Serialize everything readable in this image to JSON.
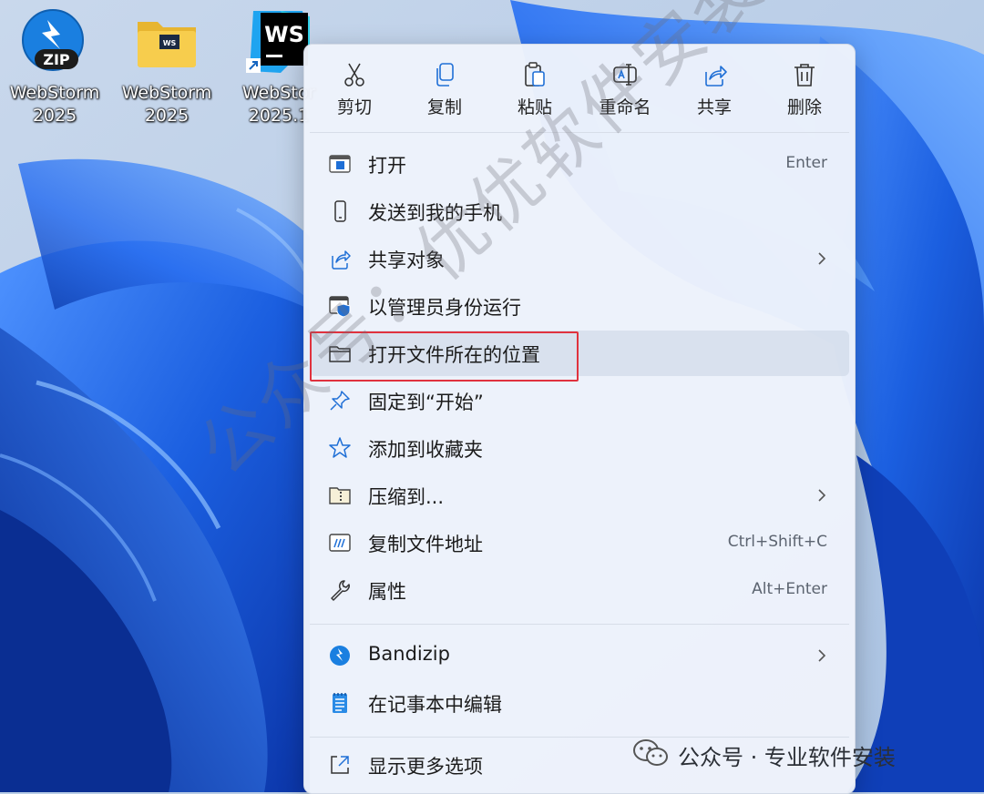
{
  "desktop": {
    "icons": [
      {
        "name": "zip-archive-icon",
        "label_line1": "WebStorm",
        "label_line2": "2025",
        "badge": "ZIP"
      },
      {
        "name": "folder-icon",
        "label_line1": "WebStorm",
        "label_line2": "2025",
        "badge": "WS"
      },
      {
        "name": "webstorm-shortcut-icon",
        "label_line1": "WebStor",
        "label_line2": "2025.1",
        "badge": "WS"
      }
    ]
  },
  "context_menu": {
    "toolbar": [
      {
        "id": "cut",
        "label": "剪切",
        "icon": "scissors-icon"
      },
      {
        "id": "copy",
        "label": "复制",
        "icon": "copy-icon"
      },
      {
        "id": "paste",
        "label": "粘贴",
        "icon": "paste-icon"
      },
      {
        "id": "rename",
        "label": "重命名",
        "icon": "rename-icon"
      },
      {
        "id": "share",
        "label": "共享",
        "icon": "share-icon"
      },
      {
        "id": "delete",
        "label": "删除",
        "icon": "trash-icon"
      }
    ],
    "items": [
      {
        "id": "open",
        "label": "打开",
        "shortcut": "Enter",
        "icon": "open-window-icon"
      },
      {
        "id": "send-to-phone",
        "label": "发送到我的手机",
        "icon": "phone-icon"
      },
      {
        "id": "share-object",
        "label": "共享对象",
        "icon": "share-icon",
        "submenu": true
      },
      {
        "id": "run-as-admin",
        "label": "以管理员身份运行",
        "icon": "shield-icon"
      },
      {
        "id": "open-location",
        "label": "打开文件所在的位置",
        "icon": "folder-icon",
        "highlighted": true
      },
      {
        "id": "pin-start",
        "label": "固定到“开始”",
        "icon": "pin-icon"
      },
      {
        "id": "add-favorites",
        "label": "添加到收藏夹",
        "icon": "star-icon"
      },
      {
        "id": "compress",
        "label": "压缩到...",
        "icon": "zip-folder-icon",
        "submenu": true
      },
      {
        "id": "copy-path",
        "label": "复制文件地址",
        "shortcut": "Ctrl+Shift+C",
        "icon": "copy-path-icon"
      },
      {
        "id": "properties",
        "label": "属性",
        "shortcut": "Alt+Enter",
        "icon": "wrench-icon"
      },
      {
        "id": "bandizip",
        "label": "Bandizip",
        "icon": "bandizip-icon",
        "submenu": true
      },
      {
        "id": "edit-notepad",
        "label": "在记事本中编辑",
        "icon": "notepad-icon"
      },
      {
        "id": "more-options",
        "label": "显示更多选项",
        "icon": "expand-icon"
      }
    ]
  },
  "watermark": {
    "text": "公众号：优优软件安装"
  },
  "credit": {
    "text": "公众号 · 专业软件安装"
  },
  "colors": {
    "accent_blue": "#1f6fd6",
    "highlight_red": "#e0323e",
    "menu_bg": "#eef3fb"
  }
}
